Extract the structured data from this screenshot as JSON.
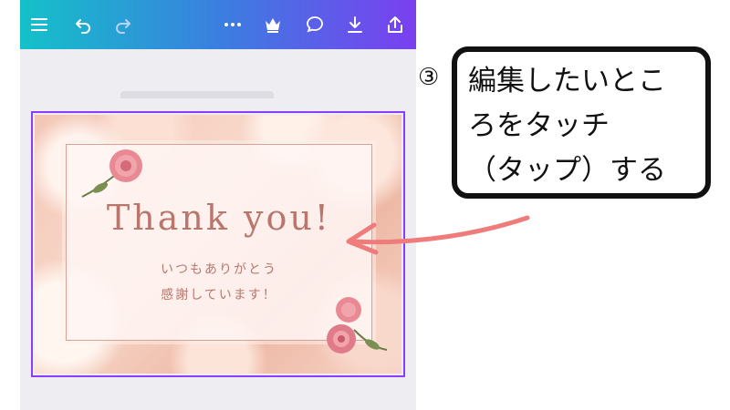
{
  "toolbar": {
    "icons": [
      "menu-icon",
      "undo-icon",
      "redo-icon",
      "more-icon",
      "crown-icon",
      "comment-icon",
      "download-icon",
      "share-icon"
    ],
    "gradient": [
      "#14c1c9",
      "#3a7fe0",
      "#7b3ff0"
    ]
  },
  "card": {
    "title": "Thank you!",
    "line1": "いつもありがとう",
    "line2": "感謝しています！",
    "text_color": "#b9766c",
    "selection_color": "#8b3dff"
  },
  "callout": {
    "number": "③",
    "lines": [
      "編集したいとこ",
      "ろをタッチ",
      "（タップ）する"
    ]
  },
  "arrow_color": "#ef7b7b"
}
